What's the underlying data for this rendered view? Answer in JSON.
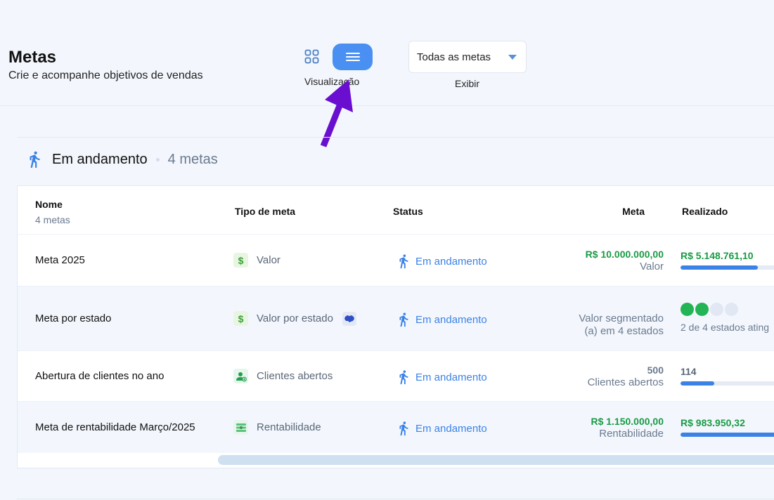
{
  "header": {
    "title": "Metas",
    "subtitle": "Crie e acompanhe objetivos de vendas",
    "view_label": "Visualização",
    "filter_value": "Todas as metas",
    "filter_label": "Exibir"
  },
  "section": {
    "title": "Em andamento",
    "count": "4 metas"
  },
  "table": {
    "headers": {
      "name": "Nome",
      "name_sub": "4 metas",
      "type": "Tipo de meta",
      "status": "Status",
      "meta": "Meta",
      "realized": "Realizado"
    },
    "rows": [
      {
        "name": "Meta 2025",
        "type": "Valor",
        "type_icon": "dollar-icon",
        "status": "Em andamento",
        "meta_main": "R$ 10.000.000,00",
        "meta_sub": "Valor",
        "realized": "R$ 5.148.761,10",
        "progress": 0.69
      },
      {
        "name": "Meta por estado",
        "type": "Valor por estado",
        "type_icon": "dollar-icon",
        "extra_icon": "map-icon",
        "status": "Em andamento",
        "meta_main": "Valor segmentado",
        "meta_sub": "(a) em 4 estados",
        "realized": "2 de 4 estados ating",
        "states_reached": 2,
        "states_total": 4
      },
      {
        "name": "Abertura de clientes no ano",
        "type": "Clientes abertos",
        "type_icon": "add-person-icon",
        "status": "Em andamento",
        "meta_main": "500",
        "meta_sub": "Clientes abertos",
        "realized": "114",
        "progress": 0.3
      },
      {
        "name": "Meta de rentabilidade Março/2025",
        "type": "Rentabilidade",
        "type_icon": "money-stack-icon",
        "status": "Em andamento",
        "meta_main": "R$ 1.150.000,00",
        "meta_sub": "Rentabilidade",
        "realized": "R$ 983.950,32",
        "progress": 0.86
      }
    ]
  },
  "colors": {
    "accent": "#4a90f2",
    "status_blue": "#3b82e6",
    "success_green": "#1a9b45",
    "annotation_arrow": "#6a0fd0"
  }
}
